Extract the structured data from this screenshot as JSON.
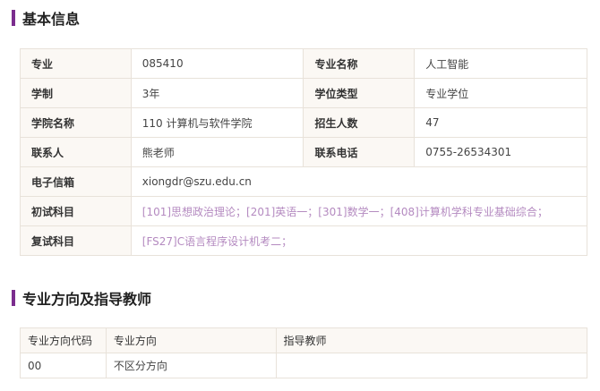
{
  "accent_color": "#7b2d8e",
  "link_color": "#b48ac0",
  "basic_info": {
    "section_title": "基本信息",
    "major_label": "专业",
    "major_code": "085410",
    "major_name_label": "专业名称",
    "major_name": "人工智能",
    "duration_label": "学制",
    "duration": "3年",
    "degree_type_label": "学位类型",
    "degree_type": "专业学位",
    "college_label": "学院名称",
    "college": "110 计算机与软件学院",
    "enrollment_label": "招生人数",
    "enrollment": "47",
    "contact_label": "联系人",
    "contact": "熊老师",
    "phone_label": "联系电话",
    "phone": "0755-26534301",
    "email_label": "电子信箱",
    "email": "xiongdr@szu.edu.cn",
    "initial_exam_label": "初试科目",
    "initial_exam_subjects": "[101]思想政治理论；[201]英语一；[301]数学一；[408]计算机学科专业基础综合；",
    "retest_label": "复试科目",
    "retest_subjects": "[FS27]C语言程序设计机考二；"
  },
  "directions": {
    "section_title": "专业方向及指导教师",
    "columns": [
      "专业方向代码",
      "专业方向",
      "指导教师"
    ],
    "rows": [
      {
        "code": "00",
        "direction": "不区分方向",
        "supervisor": ""
      }
    ]
  }
}
